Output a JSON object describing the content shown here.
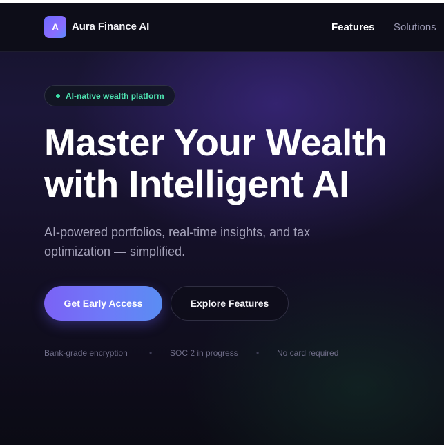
{
  "navbar": {
    "logo_letter": "A",
    "brand_name": "Aura Finance AI",
    "links": [
      {
        "label": "Features"
      },
      {
        "label": "Solutions"
      }
    ]
  },
  "hero": {
    "badge": "AI-native wealth platform",
    "title_lines": [
      "Master Your Wealth",
      "with Intelligent AI"
    ],
    "subtitle": "AI-powered portfolios, real-time insights, and tax optimization — simplified.",
    "primary_cta": "Get Early Access",
    "secondary_cta": "Explore Features",
    "trust_items": [
      "Bank-grade encryption",
      "SOC 2 in progress",
      "No card required"
    ],
    "trust_separator": "•"
  },
  "colors": {
    "accent_start": "#7b62f5",
    "accent_end": "#5a8df3",
    "badge_text": "#4ee3b1",
    "background": "#141027"
  }
}
